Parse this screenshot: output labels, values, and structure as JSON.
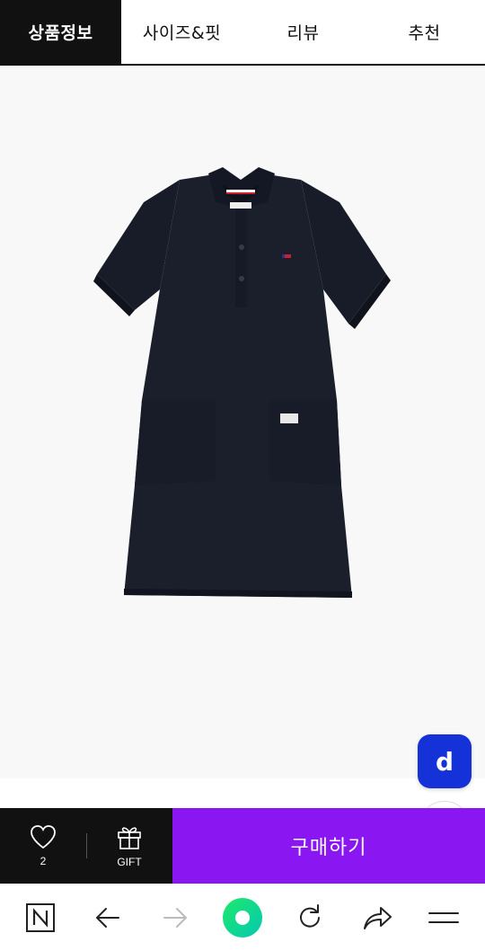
{
  "tabs": [
    {
      "label": "상품정보",
      "active": true
    },
    {
      "label": "사이즈&핏",
      "active": false
    },
    {
      "label": "리뷰",
      "active": false
    },
    {
      "label": "추천",
      "active": false
    }
  ],
  "floating": {
    "d_button_label": "d",
    "d_button_color": "#1432d8"
  },
  "purchase_bar": {
    "wishlist_count": "2",
    "gift_label": "GIFT",
    "buy_label": "구매하기",
    "buy_color": "#8a16f2"
  },
  "browser_nav": {
    "items": [
      "naver-home-icon",
      "back-arrow-icon",
      "forward-arrow-icon",
      "green-dot-icon",
      "refresh-icon",
      "share-icon",
      "menu-icon"
    ]
  }
}
